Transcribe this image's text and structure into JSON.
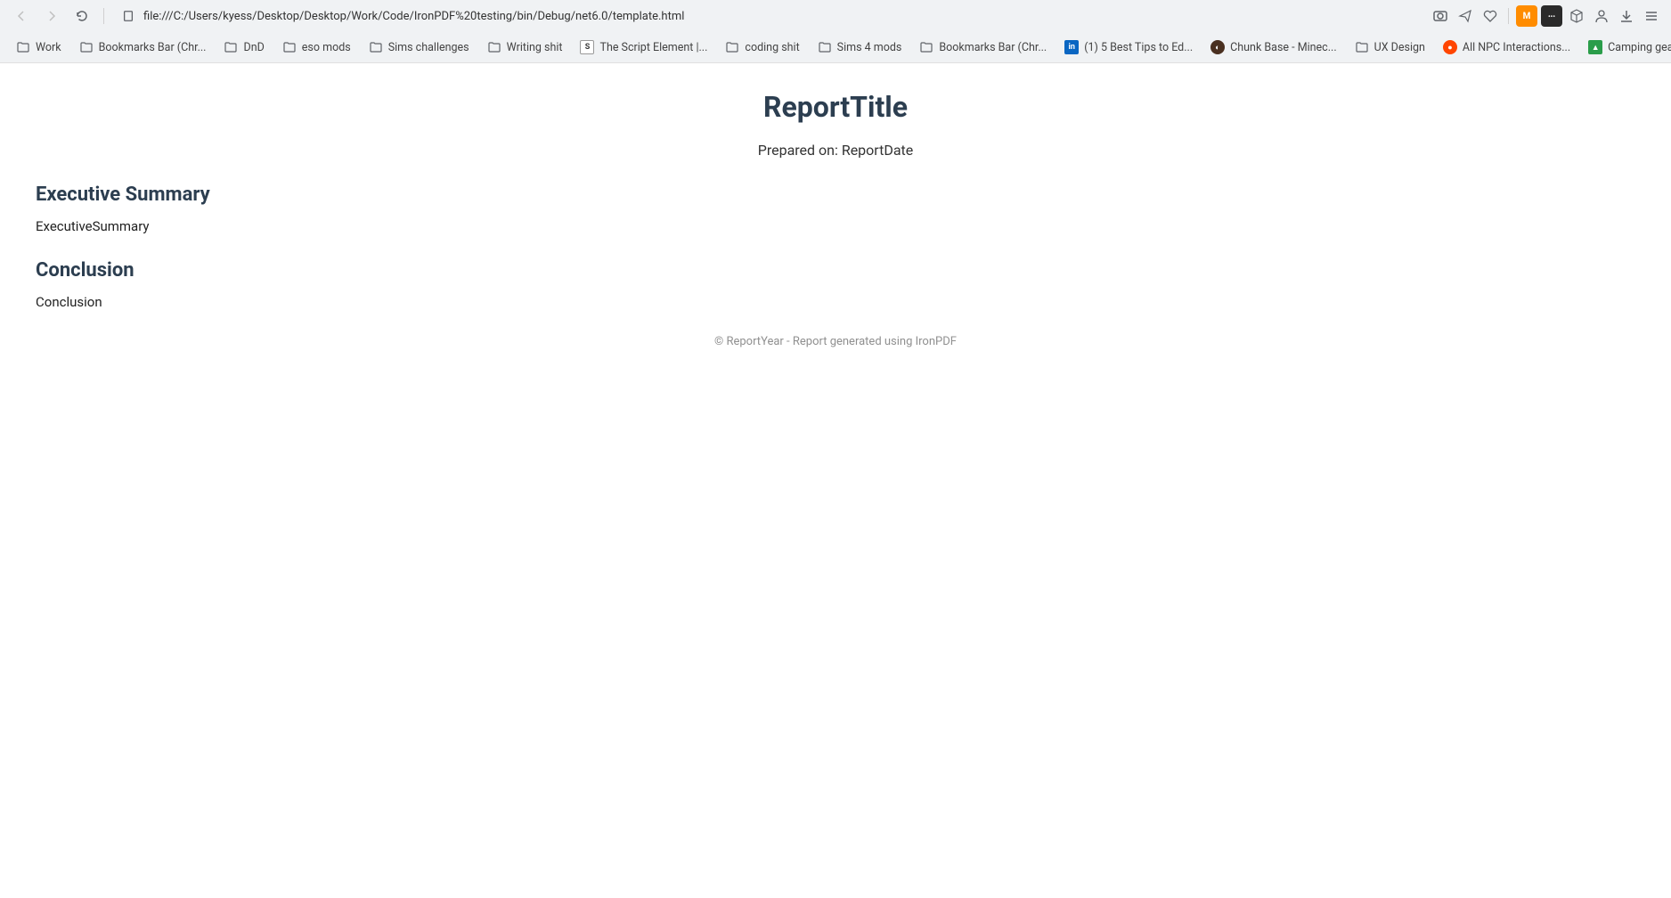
{
  "toolbar": {
    "url": "file:///C:/Users/kyess/Desktop/Desktop/Work/Code/IronPDF%20testing/bin/Debug/net6.0/template.html"
  },
  "bookmarks": [
    {
      "label": "Work",
      "type": "folder"
    },
    {
      "label": "Bookmarks Bar (Chr...",
      "type": "folder"
    },
    {
      "label": "DnD",
      "type": "folder"
    },
    {
      "label": "eso mods",
      "type": "folder"
    },
    {
      "label": "Sims challenges",
      "type": "folder"
    },
    {
      "label": "Writing shit",
      "type": "folder"
    },
    {
      "label": "The Script Element |...",
      "type": "script"
    },
    {
      "label": "coding shit",
      "type": "folder"
    },
    {
      "label": "Sims 4 mods",
      "type": "folder"
    },
    {
      "label": "Bookmarks Bar (Chr...",
      "type": "folder"
    },
    {
      "label": "(1) 5 Best Tips to Ed...",
      "type": "linkedin"
    },
    {
      "label": "Chunk Base - Minec...",
      "type": "chunk"
    },
    {
      "label": "UX Design",
      "type": "folder"
    },
    {
      "label": "All NPC Interactions...",
      "type": "reddit"
    },
    {
      "label": "Camping gear list:...",
      "type": "camping"
    }
  ],
  "report": {
    "title": "ReportTitle",
    "prepared_prefix": "Prepared on: ",
    "prepared_date": "ReportDate",
    "sections": [
      {
        "heading": "Executive Summary",
        "body": "ExecutiveSummary"
      },
      {
        "heading": "Conclusion",
        "body": "Conclusion"
      }
    ],
    "footer": "© ReportYear - Report generated using IronPDF"
  }
}
